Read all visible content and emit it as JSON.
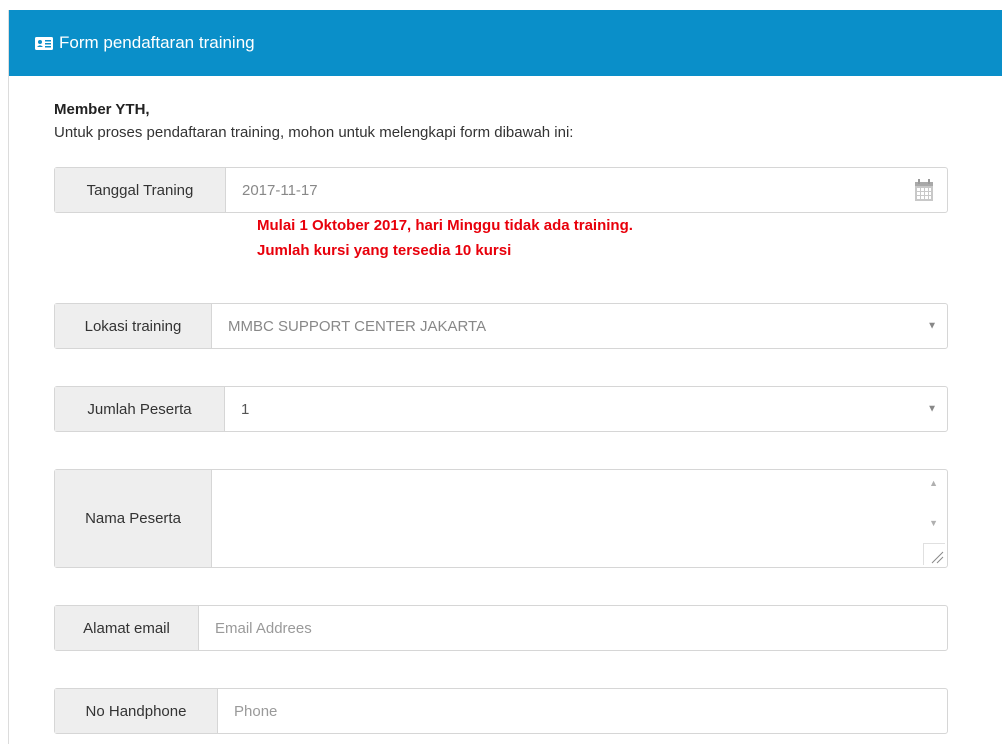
{
  "panel": {
    "title": "Form pendaftaran training",
    "header_color": "#0a8fc9",
    "title_icon": "id-card-icon"
  },
  "greeting": "Member YTH,",
  "intro": "Untuk proses pendaftaran training, mohon untuk melengkapi form dibawah ini:",
  "date_field": {
    "label": "Tanggal Traning",
    "value": "2017-11-17",
    "icon": "calendar-icon"
  },
  "notice": {
    "line1": "Mulai 1 Oktober 2017, hari Minggu tidak ada training.",
    "line2": "Jumlah kursi yang tersedia 10 kursi",
    "color": "#e8000b"
  },
  "location_field": {
    "label": "Lokasi training",
    "value": "MMBC SUPPORT CENTER JAKARTA"
  },
  "participants_field": {
    "label": "Jumlah Peserta",
    "value": "1"
  },
  "names_field": {
    "label": "Nama Peserta",
    "value": ""
  },
  "email_field": {
    "label": "Alamat email",
    "placeholder": "Email Addrees"
  },
  "phone_field": {
    "label": "No Handphone",
    "placeholder": "Phone"
  }
}
